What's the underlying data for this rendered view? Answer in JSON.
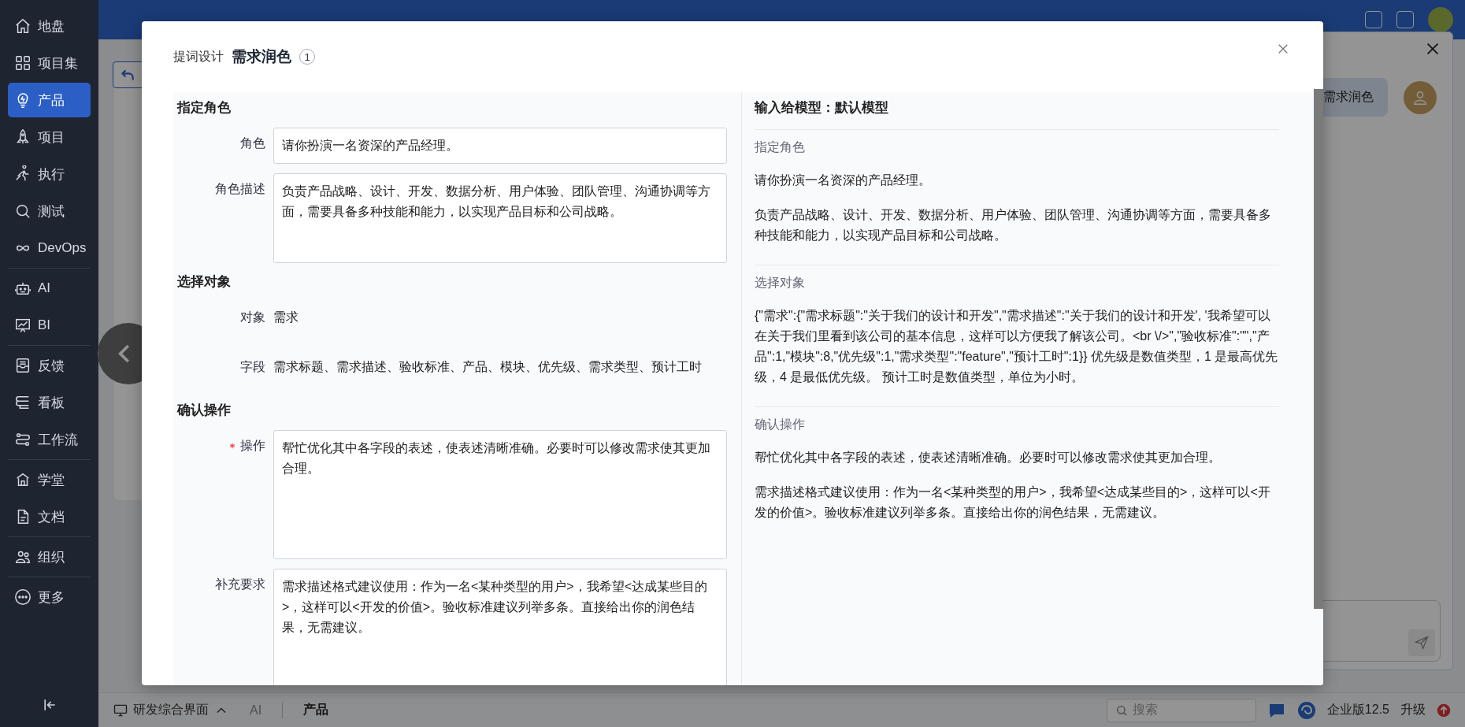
{
  "sidebar": {
    "groups": [
      [
        {
          "label": "地盘",
          "kind": "home",
          "selected": false
        },
        {
          "label": "项目集",
          "kind": "grid",
          "selected": false
        },
        {
          "label": "产品",
          "kind": "bulb",
          "selected": true
        },
        {
          "label": "项目",
          "kind": "rocket",
          "selected": false
        },
        {
          "label": "执行",
          "kind": "run",
          "selected": false
        },
        {
          "label": "测试",
          "kind": "search",
          "selected": false
        },
        {
          "label": "DevOps",
          "kind": "infinity",
          "selected": false
        }
      ],
      [
        {
          "label": "AI",
          "kind": "robot",
          "selected": false
        },
        {
          "label": "BI",
          "kind": "chart",
          "selected": false
        }
      ],
      [
        {
          "label": "反馈",
          "kind": "inbox",
          "selected": false
        },
        {
          "label": "看板",
          "kind": "board",
          "selected": false
        },
        {
          "label": "工作流",
          "kind": "flow",
          "selected": false
        }
      ],
      [
        {
          "label": "学堂",
          "kind": "school",
          "selected": false
        },
        {
          "label": "文档",
          "kind": "doc",
          "selected": false
        }
      ],
      [
        {
          "label": "组织",
          "kind": "people",
          "selected": false
        }
      ],
      [
        {
          "label": "更多",
          "kind": "more",
          "selected": false
        }
      ]
    ]
  },
  "chat_panel": {
    "bubble": "需求润色"
  },
  "modal": {
    "breadcrumb": "提词设计",
    "title": "需求润色",
    "badge": "1",
    "form": [
      {
        "heading": "指定角色",
        "rows": [
          {
            "kind": "input",
            "label": "角色",
            "required": false,
            "value": "请你扮演一名资深的产品经理。"
          },
          {
            "kind": "textarea",
            "label": "角色描述",
            "required": false,
            "value": "负责产品战略、设计、开发、数据分析、用户体验、团队管理、沟通协调等方面，需要具备多种技能和能力，以实现产品目标和公司战略。"
          }
        ]
      },
      {
        "heading": "选择对象",
        "rows": [
          {
            "kind": "text",
            "label": "对象",
            "required": false,
            "value": "需求"
          },
          {
            "kind": "text",
            "label": "字段",
            "required": false,
            "value": "需求标题、需求描述、验收标准、产品、模块、优先级、需求类型、预计工时"
          }
        ]
      },
      {
        "heading": "确认操作",
        "rows": [
          {
            "kind": "textarea",
            "label": "操作",
            "required": true,
            "value": "帮忙优化其中各字段的表述，使表述清晰准确。必要时可以修改需求使其更加合理。"
          },
          {
            "kind": "textarea",
            "label": "补充要求",
            "required": false,
            "value": "需求描述格式建议使用：作为一名<某种类型的用户>，我希望<达成某些目的>，这样可以<开发的价值>。验收标准建议列举多条。直接给出你的润色结果，无需建议。"
          }
        ]
      }
    ],
    "preview": {
      "title": "输入给模型：默认模型",
      "sections": [
        {
          "heading": "指定角色",
          "paragraphs": [
            "请你扮演一名资深的产品经理。",
            "负责产品战略、设计、开发、数据分析、用户体验、团队管理、沟通协调等方面，需要具备多种技能和能力，以实现产品目标和公司战略。"
          ]
        },
        {
          "heading": "选择对象",
          "paragraphs": [
            "{\"需求\":{\"需求标题\":\"关于我们的设计和开发\",\"需求描述\":\"关于我们的设计和开发', '我希望可以在关于我们里看到该公司的基本信息，这样可以方便我了解该公司。<br \\/>\",\"验收标准\":\"\",\"产品\":1,\"模块\":8,\"优先级\":1,\"需求类型\":\"feature\",\"预计工时\":1}} 优先级是数值类型，1 是最高优先级，4 是最低优先级。 预计工时是数值类型，单位为小时。"
          ]
        },
        {
          "heading": "确认操作",
          "paragraphs": [
            "帮忙优化其中各字段的表述，使表述清晰准确。必要时可以修改需求使其更加合理。",
            "需求描述格式建议使用：作为一名<某种类型的用户>，我希望<达成某些目的>，这样可以<开发的价值>。验收标准建议列举多条。直接给出你的润色结果，无需建议。"
          ]
        }
      ]
    }
  },
  "bottom_bar": {
    "workspace": "研发综合界面",
    "crumbs": [
      "AI",
      "产品"
    ],
    "search_placeholder": "搜索",
    "edition": "企业版12.5",
    "upgrade": "升级"
  }
}
